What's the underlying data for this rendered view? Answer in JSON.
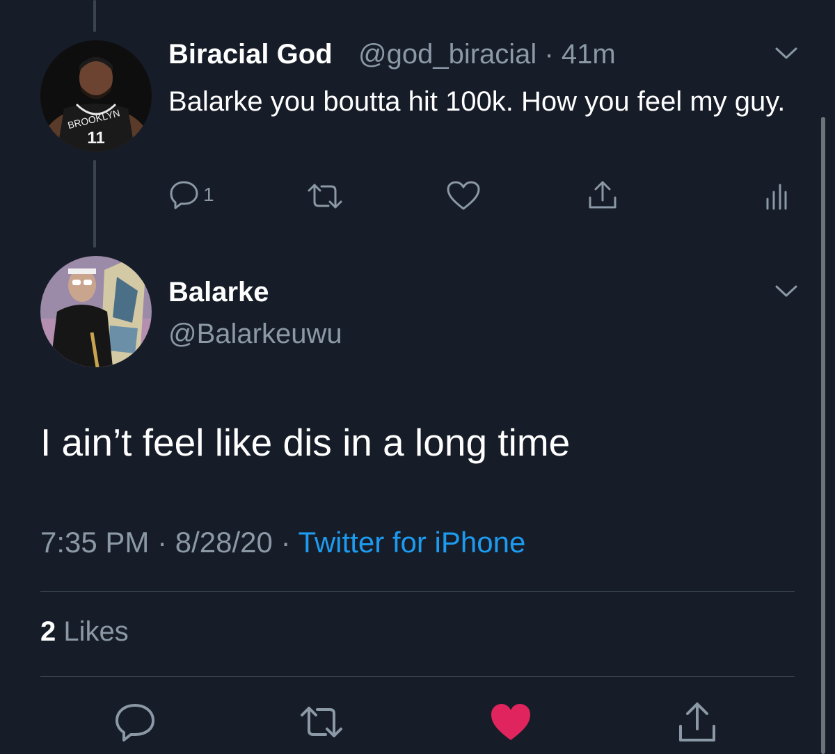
{
  "parent_tweet": {
    "display_name": "Biracial God",
    "handle": "@god_biracial",
    "time_sep": "·",
    "time": "41m",
    "text": "Balarke you boutta hit 100k. How you feel my guy.",
    "reply_count": "1",
    "avatar_jersey_text": "BROOKLYN",
    "avatar_jersey_number": "11",
    "icons": [
      "reply-icon",
      "retweet-icon",
      "like-icon",
      "share-icon",
      "analytics-icon",
      "chevron-down-icon"
    ]
  },
  "main_tweet": {
    "display_name": "Balarke",
    "handle": "@Balarkeuwu",
    "text": "I ain’t feel like dis in a long time",
    "time": "7:35 PM",
    "sep": "·",
    "date": "8/28/20",
    "source": "Twitter for iPhone",
    "likes_count": "2",
    "likes_label": "Likes",
    "liked": true,
    "icons": [
      "reply-icon",
      "retweet-icon",
      "liked-heart-icon",
      "share-icon",
      "chevron-down-icon"
    ]
  },
  "colors": {
    "background": "#161d28",
    "primary_text": "#ffffff",
    "secondary_text": "#8b98a5",
    "link": "#1d9bf0",
    "like": "#e0245e",
    "divider": "#38434f"
  }
}
